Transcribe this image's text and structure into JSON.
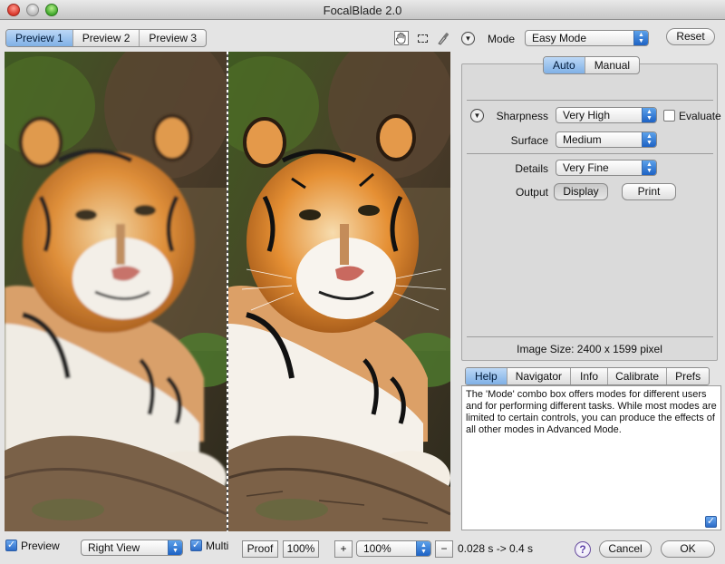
{
  "window": {
    "title": "FocalBlade 2.0"
  },
  "preview_tabs": [
    "Preview 1",
    "Preview 2",
    "Preview 3"
  ],
  "preview_tabs_active": 0,
  "toolbar": {
    "hand_icon": "hand-icon",
    "marquee_icon": "marquee-select-icon",
    "eyedropper_icon": "eyedropper-icon",
    "mode_label": "Mode",
    "mode_value": "Easy Mode",
    "reset_label": "Reset"
  },
  "settings_tabs": [
    "Auto",
    "Manual"
  ],
  "settings": {
    "sharpness_label": "Sharpness",
    "sharpness_value": "Very High",
    "evaluate_label": "Evaluate",
    "surface_label": "Surface",
    "surface_value": "Medium",
    "details_label": "Details",
    "details_value": "Very Fine",
    "output_label": "Output",
    "display_label": "Display",
    "print_label": "Print"
  },
  "image_size": "Image Size:  2400 x 1599 pixel",
  "info_tabs": [
    "Help",
    "Navigator",
    "Info",
    "Calibrate",
    "Prefs"
  ],
  "help_text": "The 'Mode' combo box offers modes for different users and for performing different tasks. While most modes are limited to certain controls, you can produce the effects of all other modes in Advanced Mode.",
  "bottom": {
    "preview_label": "Preview",
    "view_value": "Right View",
    "multi_label": "Multi",
    "proof_label": "Proof",
    "hundred_label": "100%",
    "plus_label": "+",
    "zoom_value": "100%",
    "minus_label": "−",
    "timing": "0.028 s -> 0.4 s",
    "help_icon_text": "?",
    "cancel_label": "Cancel",
    "ok_label": "OK"
  }
}
